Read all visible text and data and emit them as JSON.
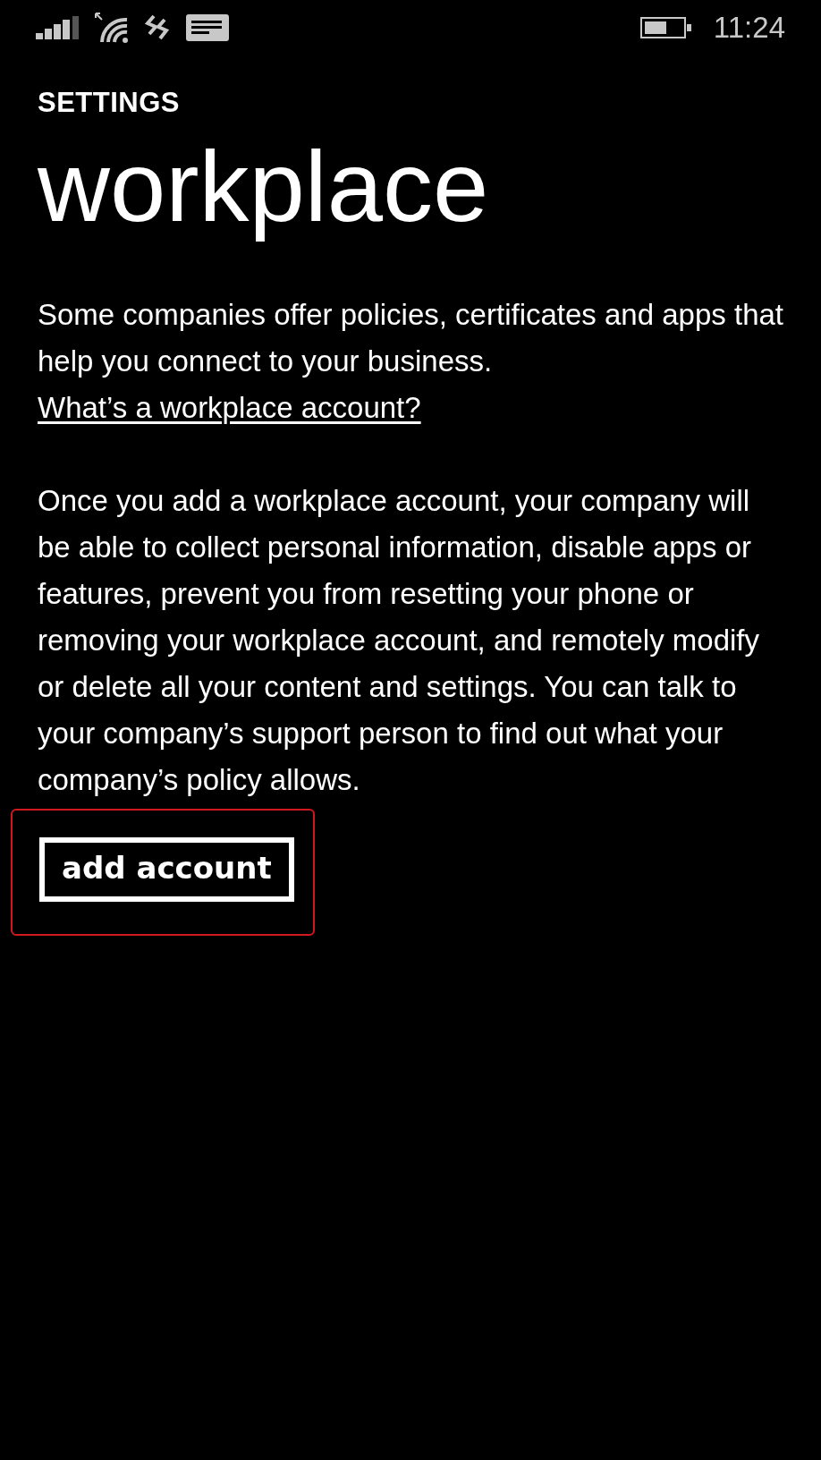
{
  "status_bar": {
    "time": "11:24"
  },
  "header": {
    "app_title": "SETTINGS",
    "page_title": "workplace"
  },
  "intro": {
    "text": "Some companies offer policies, certificates and apps that help you connect to your business.",
    "link": "What’s a workplace account?"
  },
  "warning": "Once you add a workplace account, your company will be able to collect personal information, disable apps or features, prevent you from resetting your phone or removing your workplace account, and remotely modify or delete all your content and settings. You can talk to your company’s support person to find out what your company’s policy allows.",
  "button": {
    "label": "add account",
    "highlighted": true
  }
}
